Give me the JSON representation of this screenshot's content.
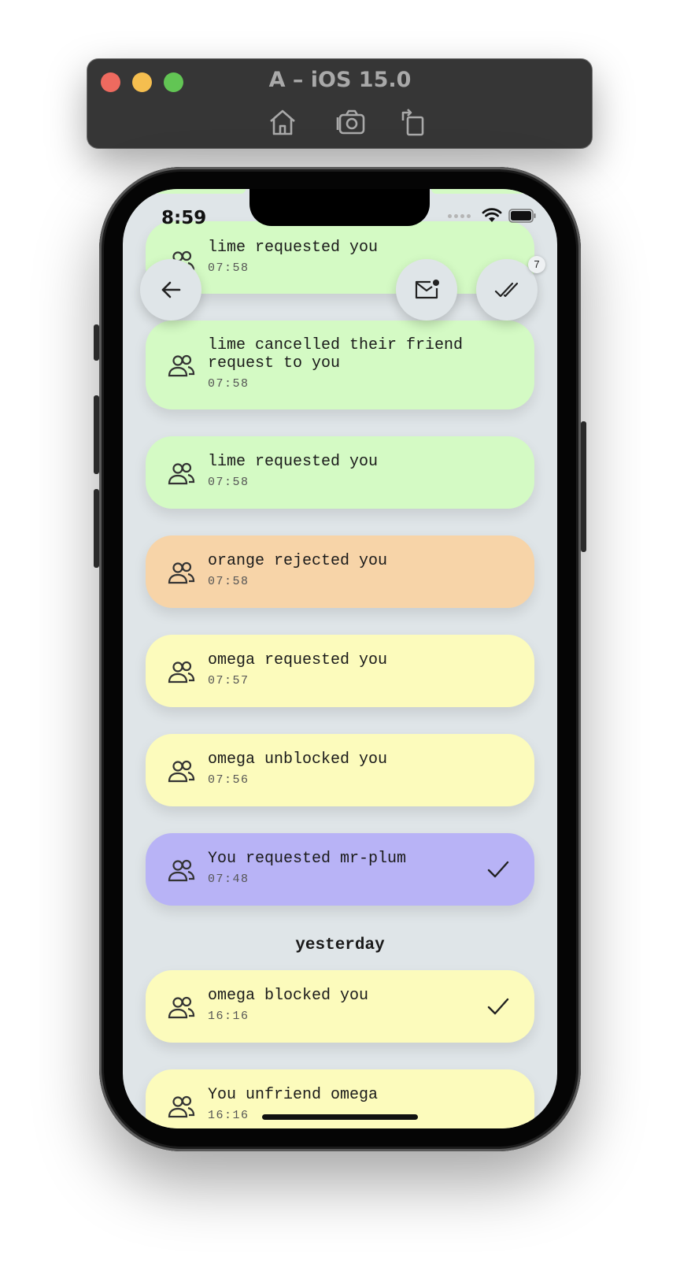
{
  "simulator": {
    "title": "A – iOS 15.0",
    "buttons": [
      "home-icon",
      "screenshot-icon",
      "rotate-icon"
    ]
  },
  "status": {
    "time": "8:59"
  },
  "actions": {
    "unread_badge": "7"
  },
  "notifications_today": [
    {
      "text": "lime requested you",
      "time": "07:58",
      "color": "#d4fac4",
      "checked": false
    },
    {
      "text": "lime cancelled their friend request to you",
      "time": "07:58",
      "color": "#d4fac4",
      "checked": false
    },
    {
      "text": "lime requested you",
      "time": "07:58",
      "color": "#d4fac4",
      "checked": false
    },
    {
      "text": "orange rejected you",
      "time": "07:58",
      "color": "#f7d4a8",
      "checked": false
    },
    {
      "text": "omega requested you",
      "time": "07:57",
      "color": "#fcfbbc",
      "checked": false
    },
    {
      "text": "omega unblocked you",
      "time": "07:56",
      "color": "#fcfbbc",
      "checked": false
    },
    {
      "text": "You requested mr-plum",
      "time": "07:48",
      "color": "#b8b3f6",
      "checked": true
    }
  ],
  "section_yesterday": "yesterday",
  "notifications_yesterday": [
    {
      "text": "omega blocked you",
      "time": "16:16",
      "color": "#fcfbbc",
      "checked": true
    },
    {
      "text": "You unfriend omega",
      "time": "16:16",
      "color": "#fcfbbc",
      "checked": false
    }
  ]
}
